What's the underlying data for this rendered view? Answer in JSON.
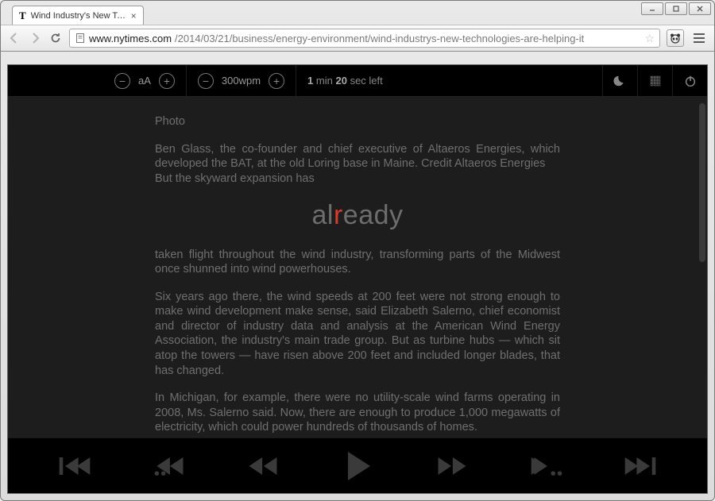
{
  "window": {
    "tab_title": "Wind Industry's New Tech…",
    "favicon_text": "T"
  },
  "url": {
    "host": "www.nytimes.com",
    "path": "/2014/03/21/business/energy-environment/wind-industrys-new-technologies-are-helping-it"
  },
  "settings": {
    "font_label": "aA",
    "wpm_label": "300wpm",
    "time_min": "1",
    "time_min_unit": "min",
    "time_sec": "20",
    "time_sec_unit": "sec left"
  },
  "focus": {
    "pre": "al",
    "pivot": "r",
    "post": "eady"
  },
  "article": {
    "photo_label": "Photo",
    "caption": "Ben Glass, the co-founder and chief executive of Altaeros Energies, which developed the BAT, at the old Loring base in Maine. Credit Altaeros Energies",
    "lead_in": "But the skyward expansion has",
    "p1": "taken flight throughout the wind industry, transforming parts of the Midwest once shunned into wind powerhouses.",
    "p2": "Six years ago there, the wind speeds at 200 feet were not strong enough to make wind development make sense, said Elizabeth Salerno, chief economist and director of industry data and analysis at the American Wind Energy Association, the industry's main trade group. But as turbine hubs — which sit atop the towers — have risen above 200 feet and included longer blades, that has changed.",
    "p3": "In Michigan, for example, there were no utility-scale wind farms operating in 2008, Ms. Salerno said. Now, there are enough to produce 1,000 megawatts of electricity, which could power hundreds of thousands of homes."
  }
}
